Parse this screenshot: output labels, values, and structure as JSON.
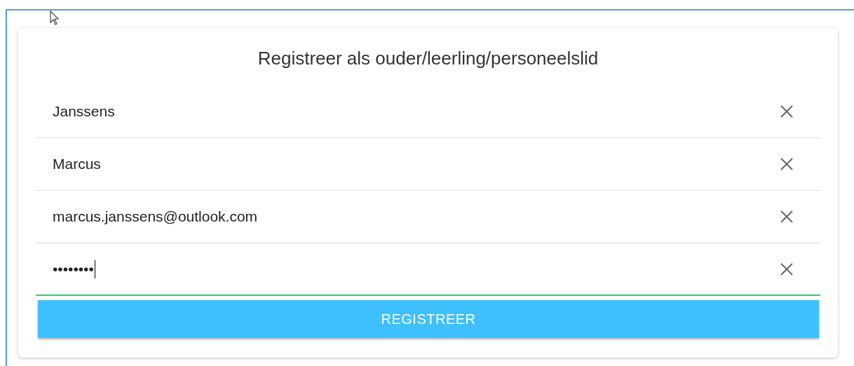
{
  "form": {
    "title": "Registreer als ouder/leerling/personeelslid",
    "fields": [
      {
        "value": "Janssens",
        "focused": false
      },
      {
        "value": "Marcus",
        "focused": false
      },
      {
        "value": "marcus.janssens@outlook.com",
        "focused": false
      },
      {
        "value": "••••••••",
        "focused": true
      }
    ],
    "submit_button": "REGISTREER"
  }
}
